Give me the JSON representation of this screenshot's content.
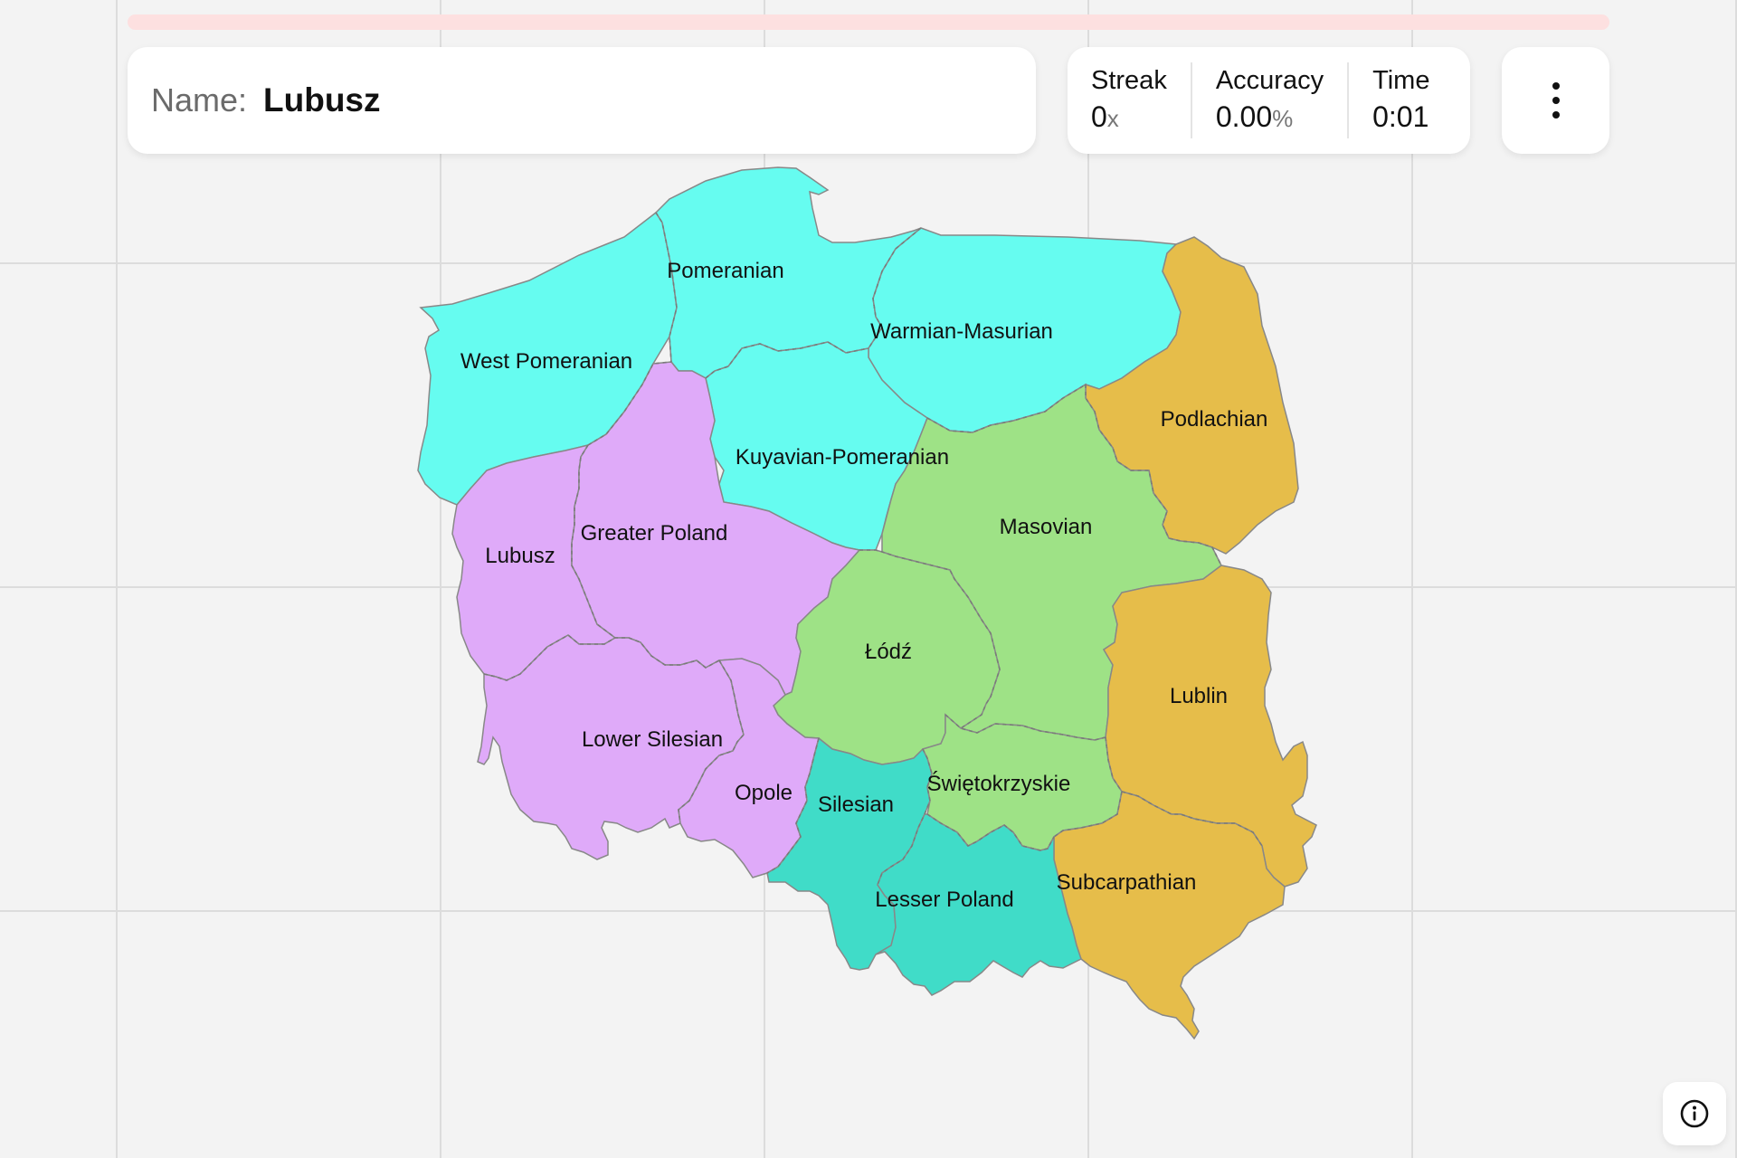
{
  "header": {
    "name_label": "Name:",
    "name_value": "Lubusz"
  },
  "stats": {
    "streak": {
      "label": "Streak",
      "value": "0",
      "unit": "x"
    },
    "accuracy": {
      "label": "Accuracy",
      "value": "0.00",
      "unit": "%"
    },
    "time": {
      "label": "Time",
      "value": "0:01"
    }
  },
  "progress": {
    "fraction": 0.0,
    "color": "#fde0e0"
  },
  "menu": {
    "icon": "more-vertical-icon"
  },
  "info": {
    "icon": "info-icon"
  },
  "map": {
    "colors": {
      "cyan": "#66fcf0",
      "violet": "#dfaaf9",
      "green": "#9ee286",
      "teal": "#40dcc8",
      "gold": "#e6bd4a"
    },
    "regions": [
      {
        "id": "west-pomeranian",
        "label": "West Pomeranian",
        "color": "#66fcf0"
      },
      {
        "id": "pomeranian",
        "label": "Pomeranian",
        "color": "#66fcf0"
      },
      {
        "id": "warmian-masurian",
        "label": "Warmian-Masurian",
        "color": "#66fcf0"
      },
      {
        "id": "kuyavian-pomeranian",
        "label": "Kuyavian-Pomeranian",
        "color": "#66fcf0"
      },
      {
        "id": "podlachian",
        "label": "Podlachian",
        "color": "#e6bd4a"
      },
      {
        "id": "lubusz",
        "label": "Lubusz",
        "color": "#dfaaf9"
      },
      {
        "id": "greater-poland",
        "label": "Greater Poland",
        "color": "#dfaaf9"
      },
      {
        "id": "masovian",
        "label": "Masovian",
        "color": "#9ee286"
      },
      {
        "id": "lodz",
        "label": "Łódź",
        "color": "#9ee286"
      },
      {
        "id": "lublin",
        "label": "Lublin",
        "color": "#e6bd4a"
      },
      {
        "id": "lower-silesian",
        "label": "Lower Silesian",
        "color": "#dfaaf9"
      },
      {
        "id": "opole",
        "label": "Opole",
        "color": "#dfaaf9"
      },
      {
        "id": "silesian",
        "label": "Silesian",
        "color": "#40dcc8"
      },
      {
        "id": "swietokrzyskie",
        "label": "Świętokrzyskie",
        "color": "#9ee286"
      },
      {
        "id": "subcarpathian",
        "label": "Subcarpathian",
        "color": "#e6bd4a"
      },
      {
        "id": "lesser-poland",
        "label": "Lesser Poland",
        "color": "#40dcc8"
      }
    ]
  }
}
